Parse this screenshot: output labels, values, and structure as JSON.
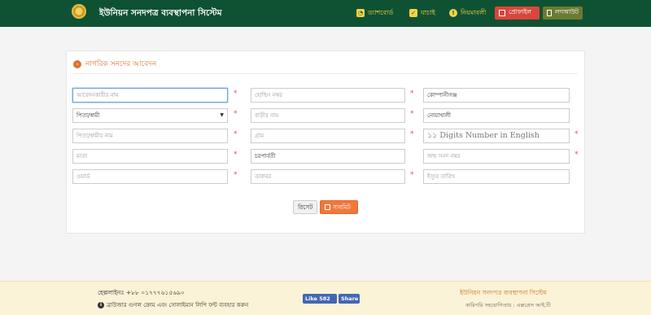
{
  "header": {
    "brand": "ইউনিয়ন সনদপত্র ব্যবস্থাপনা সিস্টেম",
    "nav": {
      "dashboard": "ড্যাশবোর্ড",
      "verify": "যাচাই",
      "rules": "নিয়মাবলী"
    },
    "profile": "প্রোফাইল",
    "logout": "লগআউট",
    "colors": {
      "bar": "#0f5233",
      "nav_text": "#f5d34b",
      "profile_bg": "#d9463c",
      "logout_bg": "#6c7a32"
    }
  },
  "panel": {
    "title": "নাগরিক সনদের আবেদন"
  },
  "form": {
    "applicant_name_ph": "আবেদনকারীর নাম",
    "holding_no_ph": "হোল্ডিং নম্বর",
    "company_value": "কোম্পানীগঞ্জ",
    "relation_value": "পিতা/স্বামী",
    "house_name_ph": "বাড়ীর নাম",
    "district_value": "নোয়াখালী",
    "father_husband_ph": "পিতা/স্বামীর নাম",
    "village_ph": "গ্রাম",
    "mobile_ph": "১১ Digits Number in English",
    "mother_ph": "মাতা",
    "union_value": "চরপার্বতী",
    "birth_cert_ph": "জন্ম সনদ নম্বর",
    "ward_ph": "ওয়ার্ড",
    "post_office_ph": "ডাকঘর",
    "issue_date_ph": "ইস্যুর তারিখ",
    "reset": "রিসেট",
    "submit": "সাবমিট"
  },
  "footer": {
    "helpline": "হেল্পলাইনঃ +৮৮ ০১৭৭৭৬১৫৬৯০",
    "browser_note": "ব্রাউজার গুগল ক্রোম এবং সোলাইমান লিপি ফন্ট ব্যবহার করুন",
    "fb_like": "Like 582",
    "fb_share": "Share",
    "right_title": "ইউনিয়ন সনদপত্র ব্যবস্থাপনা সিস্টেম",
    "right_sub": "কারিগরি সহযোগিতায় : এক্সপ্রেস আই,টি"
  }
}
